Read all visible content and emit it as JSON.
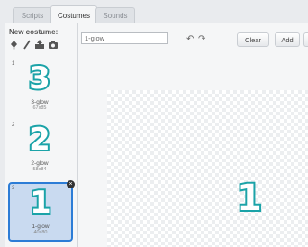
{
  "tabs": [
    "Scripts",
    "Costumes",
    "Sounds"
  ],
  "new_costume_label": "New costume:",
  "tools": [
    "paint-brush-icon",
    "slash-icon",
    "upload-icon",
    "camera-icon"
  ],
  "costumes": [
    {
      "index": "1",
      "glyph": "3",
      "name": "3-glow",
      "size": "67x85"
    },
    {
      "index": "2",
      "glyph": "2",
      "name": "2-glow",
      "size": "58x84"
    },
    {
      "index": "3",
      "glyph": "1",
      "name": "1-glow",
      "size": "40x80",
      "selected": true
    }
  ],
  "editor": {
    "costume_name": "1-glow",
    "clear_label": "Clear",
    "add_label": "Add",
    "canvas_glyph": "1"
  },
  "colors": {
    "glyph_outline": "#1ba3a8",
    "selected_border": "#2c7cd6"
  }
}
